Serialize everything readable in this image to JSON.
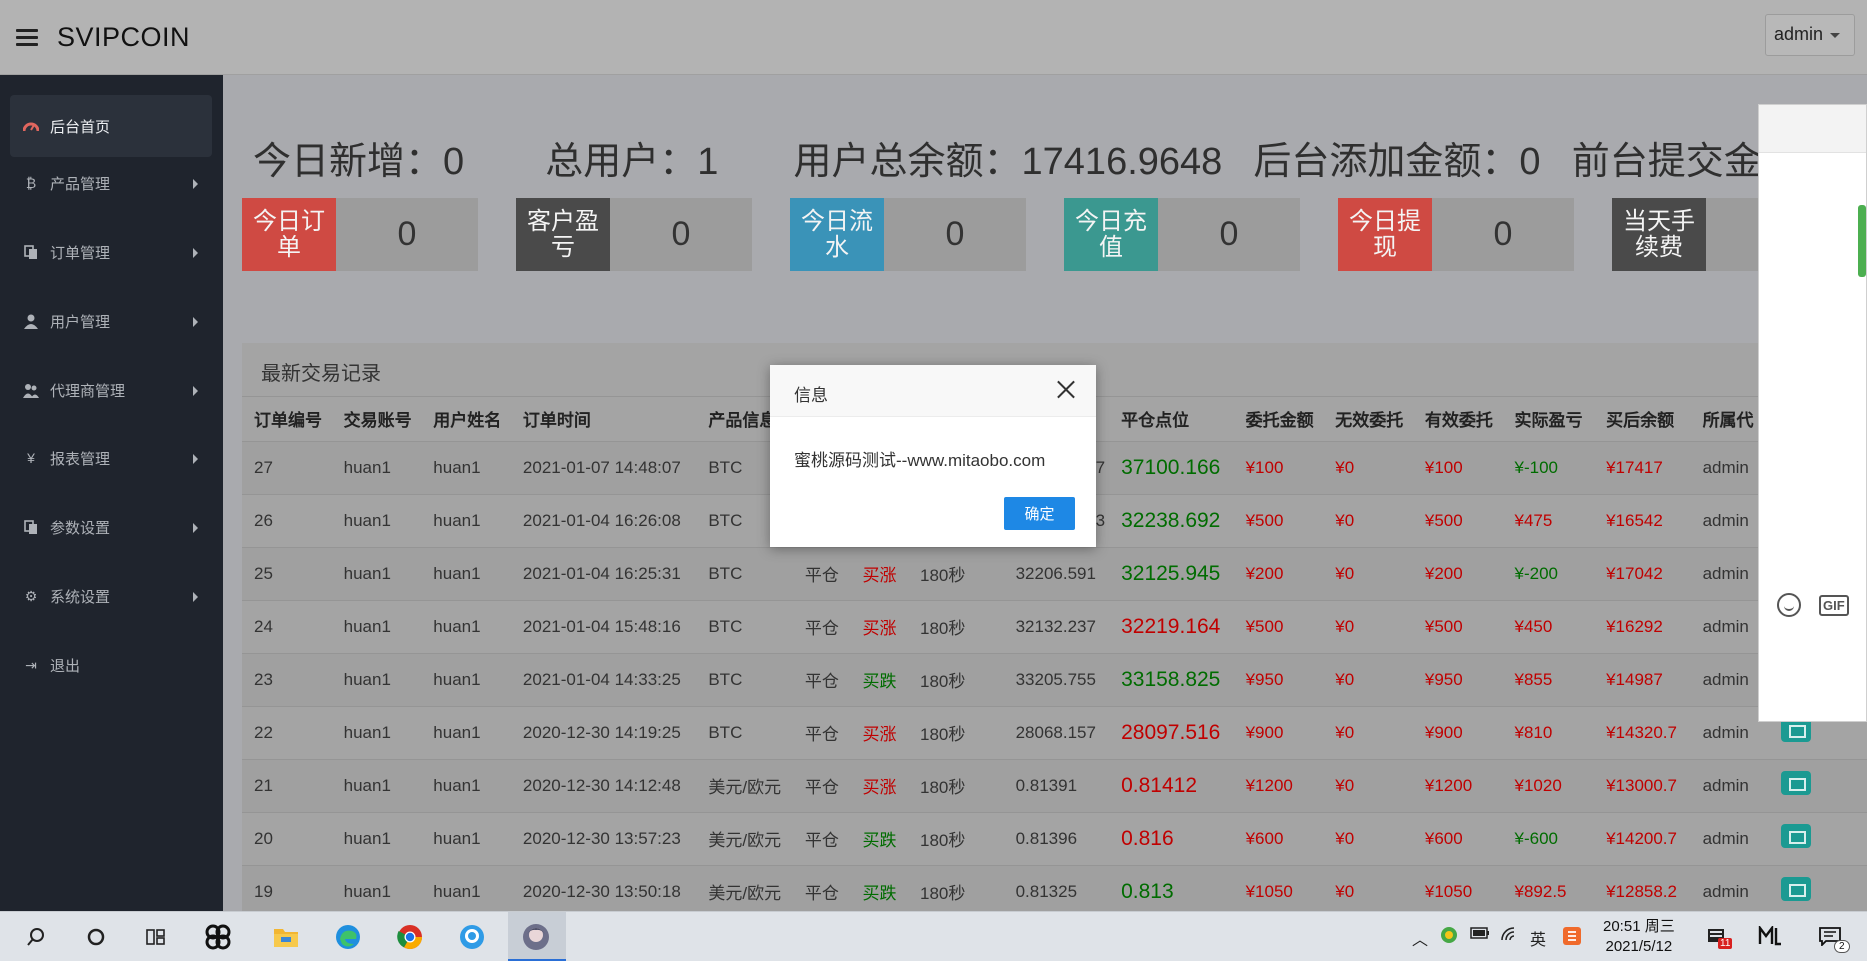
{
  "header": {
    "brand": "SVIPCOIN",
    "user": "admin"
  },
  "sidebar": {
    "items": [
      {
        "label": "后台首页",
        "icon": "dashboard-icon"
      },
      {
        "label": "产品管理",
        "icon": "bitcoin-icon"
      },
      {
        "label": "订单管理",
        "icon": "copy-icon"
      },
      {
        "label": "用户管理",
        "icon": "user-icon"
      },
      {
        "label": "代理商管理",
        "icon": "users-icon"
      },
      {
        "label": "报表管理",
        "icon": "yen-icon"
      },
      {
        "label": "参数设置",
        "icon": "copy-icon"
      },
      {
        "label": "系统设置",
        "icon": "gears-icon"
      },
      {
        "label": "退出",
        "icon": "sign-out-icon"
      }
    ]
  },
  "summary": {
    "new_today": "今日新增：0",
    "total_users": "总用户：1",
    "total_balance": "用户总余额：17416.9648",
    "admin_added": "后台添加金额：0",
    "front_submitted": "前台提交金额："
  },
  "stats": [
    {
      "label": "今日订单",
      "value": "0",
      "color": "#cf4a43"
    },
    {
      "label": "客户盈亏",
      "value": "0",
      "color": "#4a4a4a"
    },
    {
      "label": "今日流水",
      "value": "0",
      "color": "#3a93b8"
    },
    {
      "label": "今日充值",
      "value": "0",
      "color": "#3b9890"
    },
    {
      "label": "今日提现",
      "value": "0",
      "color": "#cf4a43"
    },
    {
      "label": "当天手续费",
      "value": "",
      "color": "#4a4a4a"
    }
  ],
  "table": {
    "title": "最新交易记录",
    "headers": [
      "订单编号",
      "交易账号",
      "用户姓名",
      "订单时间",
      "产品信息",
      "",
      "",
      "",
      "",
      "平仓点位",
      "委托金额",
      "无效委托",
      "有效委托",
      "实际盈亏",
      "买后余额",
      "所属代"
    ],
    "rows": [
      [
        "27",
        "huan1",
        "huan1",
        "2021-01-07 14:48:07",
        "BTC",
        "",
        "",
        "",
        "7",
        "37100.166",
        "¥100",
        "¥0",
        "¥100",
        "¥-100",
        "¥17417",
        "admin"
      ],
      [
        "26",
        "huan1",
        "huan1",
        "2021-01-04 16:26:08",
        "BTC",
        "",
        "",
        "",
        "3",
        "32238.692",
        "¥500",
        "¥0",
        "¥500",
        "¥475",
        "¥16542",
        "admin"
      ],
      [
        "25",
        "huan1",
        "huan1",
        "2021-01-04 16:25:31",
        "BTC",
        "平仓",
        "买涨",
        "180秒",
        "32206.591",
        "32125.945",
        "¥200",
        "¥0",
        "¥200",
        "¥-200",
        "¥17042",
        "admin"
      ],
      [
        "24",
        "huan1",
        "huan1",
        "2021-01-04 15:48:16",
        "BTC",
        "平仓",
        "买涨",
        "180秒",
        "32132.237",
        "32219.164",
        "¥500",
        "¥0",
        "¥500",
        "¥450",
        "¥16292",
        "admin"
      ],
      [
        "23",
        "huan1",
        "huan1",
        "2021-01-04 14:33:25",
        "BTC",
        "平仓",
        "买跌",
        "180秒",
        "33205.755",
        "33158.825",
        "¥950",
        "¥0",
        "¥950",
        "¥855",
        "¥14987",
        "admin"
      ],
      [
        "22",
        "huan1",
        "huan1",
        "2020-12-30 14:19:25",
        "BTC",
        "平仓",
        "买涨",
        "180秒",
        "28068.157",
        "28097.516",
        "¥900",
        "¥0",
        "¥900",
        "¥810",
        "¥14320.7",
        "admin"
      ],
      [
        "21",
        "huan1",
        "huan1",
        "2020-12-30 14:12:48",
        "美元/欧元",
        "平仓",
        "买涨",
        "180秒",
        "0.81391",
        "0.81412",
        "¥1200",
        "¥0",
        "¥1200",
        "¥1020",
        "¥13000.7",
        "admin"
      ],
      [
        "20",
        "huan1",
        "huan1",
        "2020-12-30 13:57:23",
        "美元/欧元",
        "平仓",
        "买跌",
        "180秒",
        "0.81396",
        "0.816",
        "¥600",
        "¥0",
        "¥600",
        "¥-600",
        "¥14200.7",
        "admin"
      ],
      [
        "19",
        "huan1",
        "huan1",
        "2020-12-30 13:50:18",
        "美元/欧元",
        "平仓",
        "买跌",
        "180秒",
        "0.81325",
        "0.813",
        "¥1050",
        "¥0",
        "¥1050",
        "¥892.5",
        "¥12858.2",
        "admin"
      ]
    ]
  },
  "modal": {
    "title": "信息",
    "message": "蜜桃源码测试--www.mitaobo.com",
    "ok_label": "确定"
  },
  "side_panel": {
    "gif_label": "GIF"
  },
  "taskbar": {
    "time": "20:51 周三",
    "date": "2021/5/12",
    "ime": "英",
    "mail_badge": "11",
    "notify_badge": "2"
  }
}
